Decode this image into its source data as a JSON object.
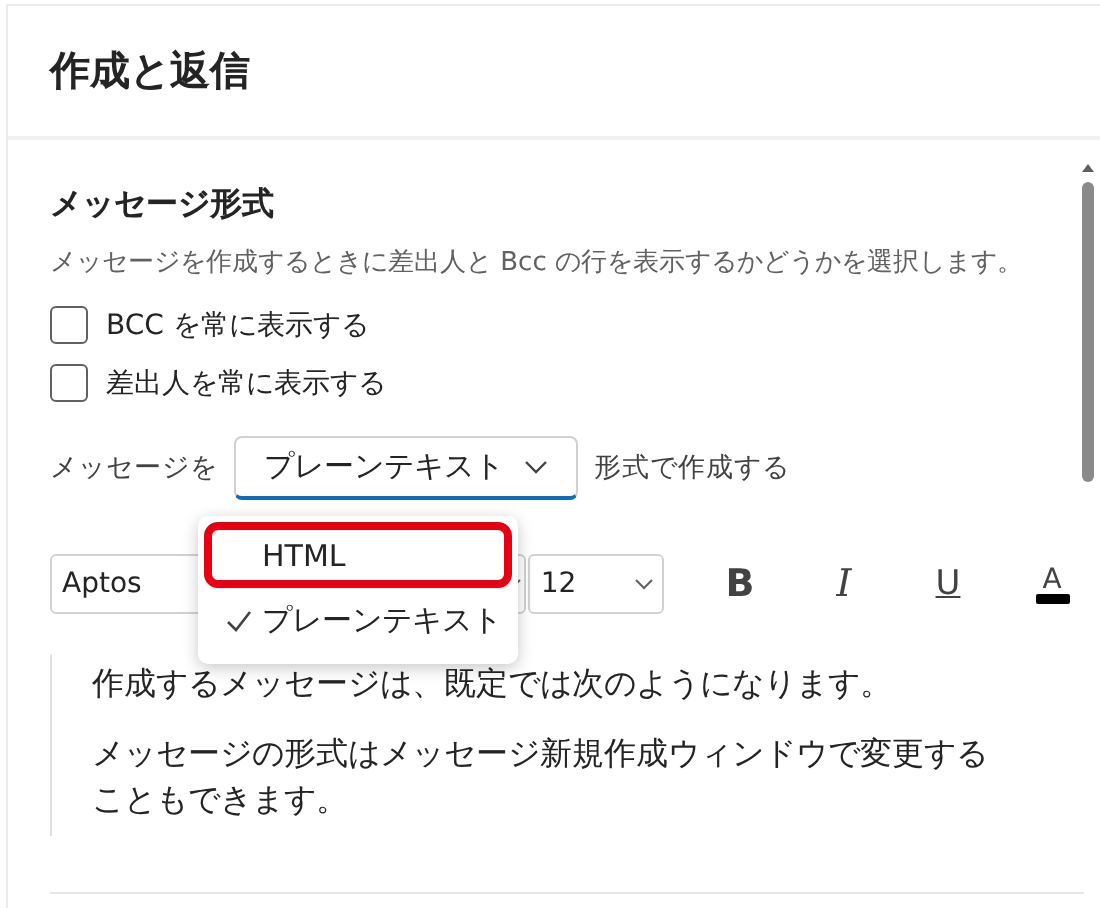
{
  "title": "作成と返信",
  "section": {
    "heading": "メッセージ形式",
    "description": "メッセージを作成するときに差出人と Bcc の行を表示するかどうかを選択します。"
  },
  "checkboxes": [
    {
      "label": "BCC を常に表示する",
      "checked": false
    },
    {
      "label": "差出人を常に表示する",
      "checked": false
    }
  ],
  "format_row": {
    "prefix": "メッセージを",
    "value": "プレーンテキスト",
    "suffix": "形式で作成する",
    "expanded": true
  },
  "format_options": [
    {
      "label": "HTML",
      "selected": false,
      "annotated": true
    },
    {
      "label": "プレーンテキスト",
      "selected": true,
      "annotated": false
    }
  ],
  "toolbar": {
    "font": "Aptos",
    "size": "12",
    "buttons": [
      {
        "kind": "bold",
        "label": "B"
      },
      {
        "kind": "italic",
        "label": "I"
      },
      {
        "kind": "underline",
        "label": "U"
      },
      {
        "kind": "color",
        "label": "A"
      }
    ]
  },
  "message": [
    "作成するメッセージは、既定では次のようになります。",
    "メッセージの形式はメッセージ新規作成ウィンドウで変更することもできます。"
  ]
}
